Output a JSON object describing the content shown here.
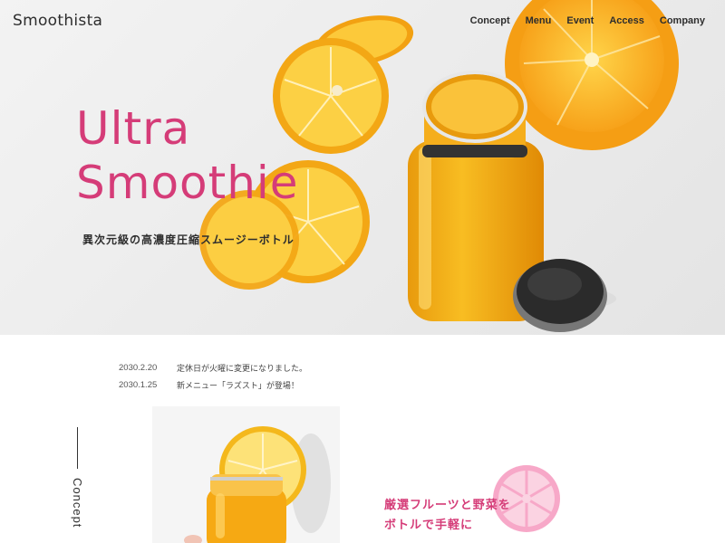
{
  "header": {
    "logo": "Smoothista",
    "nav": [
      "Concept",
      "Menu",
      "Event",
      "Access",
      "Company"
    ]
  },
  "hero": {
    "title_line1": "Ultra",
    "title_line2": "Smoothie",
    "subtitle": "異次元級の高濃度圧縮スムージーボトル"
  },
  "news": [
    {
      "date": "2030.2.20",
      "text": "定休日が火曜に変更になりました。"
    },
    {
      "date": "2030.1.25",
      "text": "新メニュー「ラズスト」が登場！"
    }
  ],
  "concept": {
    "label": "Concept",
    "catch_line1": "厳選フルーツと野菜を",
    "catch_line2": "ボトルで手軽に"
  },
  "colors": {
    "accent": "#d53c78",
    "orange": "#f5a41b",
    "juice": "#f6b31a",
    "cap": "#2b2b2b",
    "grapefruit": "#f7a8c8"
  }
}
